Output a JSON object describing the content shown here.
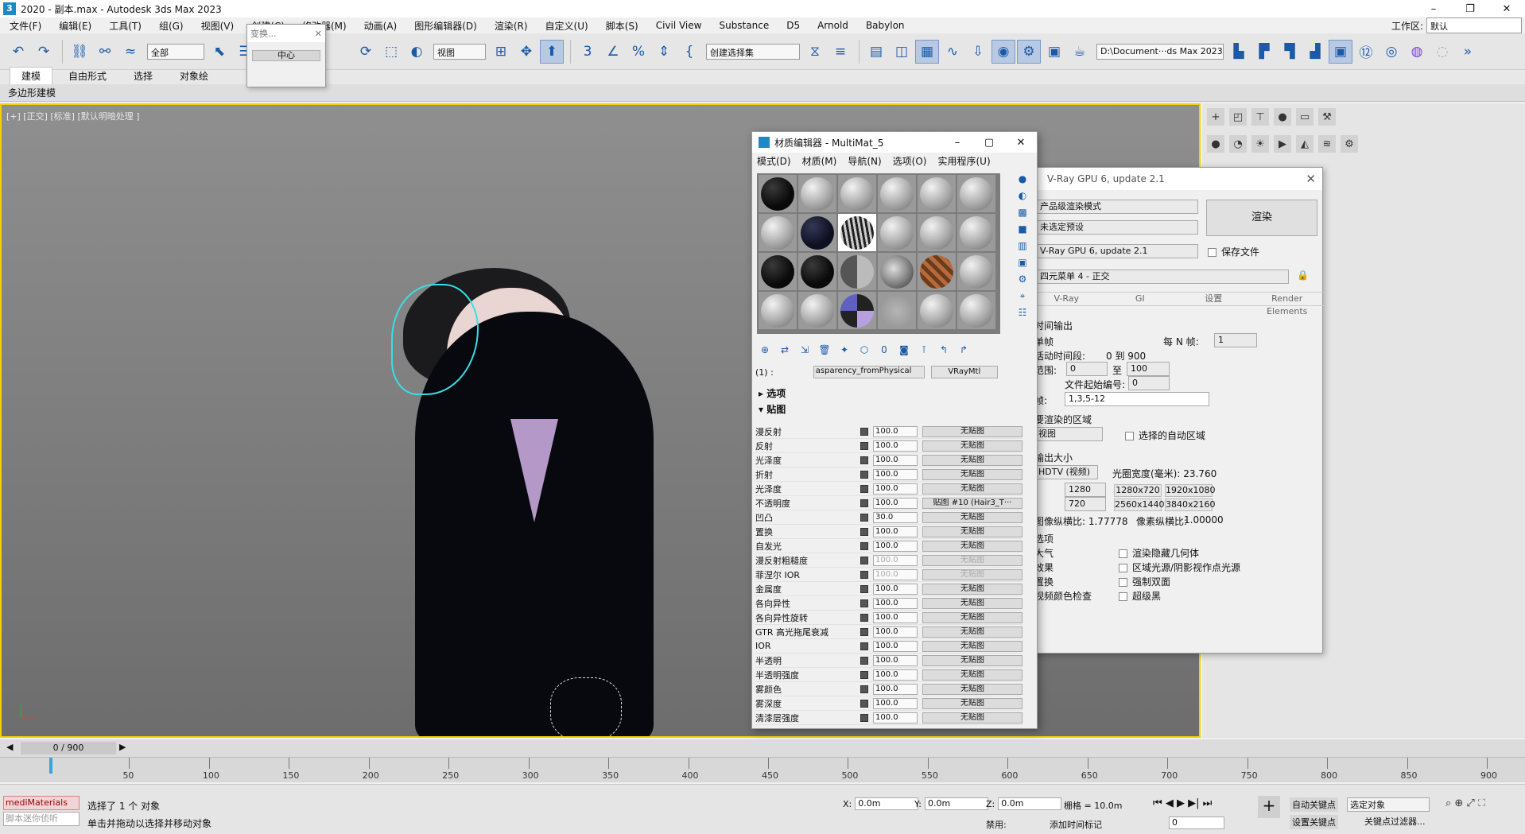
{
  "window": {
    "title": "2020 - 副本.max - Autodesk 3ds Max 2023",
    "app_icon": "3"
  },
  "menu": {
    "items": [
      "文件(F)",
      "编辑(E)",
      "工具(T)",
      "组(G)",
      "视图(V)",
      "创建(C)",
      "修改器(M)",
      "动画(A)",
      "图形编辑器(D)",
      "渲染(R)",
      "自定义(U)",
      "脚本(S)",
      "Civil View",
      "Substance",
      "D5",
      "Arnold",
      "Babylon"
    ],
    "workspace_label": "工作区:",
    "workspace_value": "默认"
  },
  "toolbar": {
    "filter_value": "全部",
    "ref_coord_value": "视图",
    "selection_set_value": "创建选择集",
    "project_path": "D:\\Document···ds Max 2023"
  },
  "ribbon": {
    "tabs": [
      "建模",
      "自由形式",
      "选择",
      "对象绘"
    ],
    "subtab": "多边形建模"
  },
  "transform_dialog": {
    "title": "变换...",
    "button": "中心"
  },
  "viewport": {
    "label": "[+] [正交] [标准] [默认明暗处理 ]"
  },
  "material_editor": {
    "title": "材质编辑器 - MultiMat_5",
    "menu": [
      "模式(D)",
      "材质(M)",
      "导航(N)",
      "选项(O)",
      "实用程序(U)"
    ],
    "slots": [
      "black",
      "gray",
      "gray",
      "gray",
      "gray",
      "gray",
      "gray",
      "navy",
      "stripe",
      "gray",
      "gray",
      "gray",
      "black",
      "black",
      "halfgray",
      "glass",
      "wood",
      "gray",
      "gray",
      "gray",
      "check",
      "noise",
      "gray",
      "gray"
    ],
    "material_index": "(1) :",
    "material_name": "asparency_fromPhysical",
    "material_type": "VRayMtl",
    "rollouts": {
      "options": "选项",
      "maps": "贴图"
    },
    "maps": [
      {
        "name": "漫反射",
        "value": "100.0",
        "map": "无贴图",
        "dim": false
      },
      {
        "name": "反射",
        "value": "100.0",
        "map": "无贴图",
        "dim": false
      },
      {
        "name": "光泽度",
        "value": "100.0",
        "map": "无贴图",
        "dim": false
      },
      {
        "name": "折射",
        "value": "100.0",
        "map": "无贴图",
        "dim": false
      },
      {
        "name": "光泽度",
        "value": "100.0",
        "map": "无贴图",
        "dim": false
      },
      {
        "name": "不透明度",
        "value": "100.0",
        "map": "贴图 #10 (Hair3_T···",
        "dim": false
      },
      {
        "name": "凹凸",
        "value": "30.0",
        "map": "无贴图",
        "dim": false
      },
      {
        "name": "置换",
        "value": "100.0",
        "map": "无贴图",
        "dim": false
      },
      {
        "name": "自发光",
        "value": "100.0",
        "map": "无贴图",
        "dim": false
      },
      {
        "name": "漫反射粗糙度",
        "value": "100.0",
        "map": "无贴图",
        "dim": true
      },
      {
        "name": "菲涅尔 IOR",
        "value": "100.0",
        "map": "无贴图",
        "dim": true
      },
      {
        "name": "金属度",
        "value": "100.0",
        "map": "无贴图",
        "dim": false
      },
      {
        "name": "各向异性",
        "value": "100.0",
        "map": "无贴图",
        "dim": false
      },
      {
        "name": "各向异性旋转",
        "value": "100.0",
        "map": "无贴图",
        "dim": false
      },
      {
        "name": "GTR 高光拖尾衰减",
        "value": "100.0",
        "map": "无贴图",
        "dim": false
      },
      {
        "name": "IOR",
        "value": "100.0",
        "map": "无贴图",
        "dim": false
      },
      {
        "name": "半透明",
        "value": "100.0",
        "map": "无贴图",
        "dim": false
      },
      {
        "name": "半透明强度",
        "value": "100.0",
        "map": "无贴图",
        "dim": false
      },
      {
        "name": "雾颜色",
        "value": "100.0",
        "map": "无贴图",
        "dim": false
      },
      {
        "name": "雾深度",
        "value": "100.0",
        "map": "无贴图",
        "dim": false
      },
      {
        "name": "清漆层强度",
        "value": "100.0",
        "map": "无贴图",
        "dim": false
      }
    ]
  },
  "render_setup": {
    "title": "V-Ray GPU 6, update 2.1",
    "target": "产品级渲染模式",
    "preset": "未选定预设",
    "renderer": "V-Ray GPU 6, update 2.1",
    "view": "四元菜单 4 - 正交",
    "render_button": "渲染",
    "save_file": "保存文件",
    "tabs": [
      "V-Ray",
      "GI",
      "设置",
      "Render Elements"
    ],
    "output_section": "时间输出",
    "single": "单帧",
    "every_n": "每 N 帧:",
    "every_n_value": "1",
    "active_segment": "活动时间段:",
    "active_range": "0 到 900",
    "range": "范围:",
    "range_from": "0",
    "range_to_label": "至",
    "range_to": "100",
    "file_start": "文件起始编号:",
    "file_start_value": "0",
    "frames_label": "帧:",
    "frames_value": "1,3,5-12",
    "area_section": "要渲染的区域",
    "area_value": "视图",
    "auto_region": "选择的自动区域",
    "size_section": "输出大小",
    "size_preset": "HDTV (视频)",
    "aperture": "光圈宽度(毫米): 23.760",
    "width": "1280",
    "height": "720",
    "presets": [
      "1280x720",
      "1920x1080",
      "2560x1440",
      "3840x2160"
    ],
    "aspect": "图像纵横比: 1.77778",
    "pixel_aspect_label": "像素纵横比:",
    "pixel_aspect": "1.00000",
    "options_section": "选项",
    "opt_left": [
      "大气",
      "效果",
      "置换",
      "视频颜色检查"
    ],
    "opt_right": [
      "渲染隐藏几何体",
      "区域光源/阴影视作点光源",
      "强制双面",
      "超级黑"
    ]
  },
  "timeline": {
    "frame_display": "0 / 900",
    "ticks": [
      "50",
      "100",
      "150",
      "200",
      "250",
      "300",
      "350",
      "400",
      "450",
      "500",
      "550",
      "600",
      "650",
      "700",
      "750",
      "800",
      "850",
      "900"
    ]
  },
  "status": {
    "script_label": "mediMaterials",
    "script_placeholder": "脚本迷你侦听",
    "message": "选择了 1 个 对象",
    "hint": "单击并拖动以选择并移动对象",
    "x_label": "X:",
    "x_value": "0.0m",
    "y_label": "Y:",
    "y_value": "0.0m",
    "z_label": "Z:",
    "z_value": "0.0m",
    "grid": "栅格 = 10.0m",
    "disable": "禁用:",
    "add_time_tag": "添加时间标记",
    "auto_key": "自动关键点",
    "selected_object": "选定对象",
    "set_key": "设置关键点",
    "key_filters": "关键点过滤器...",
    "current_frame": "0"
  }
}
